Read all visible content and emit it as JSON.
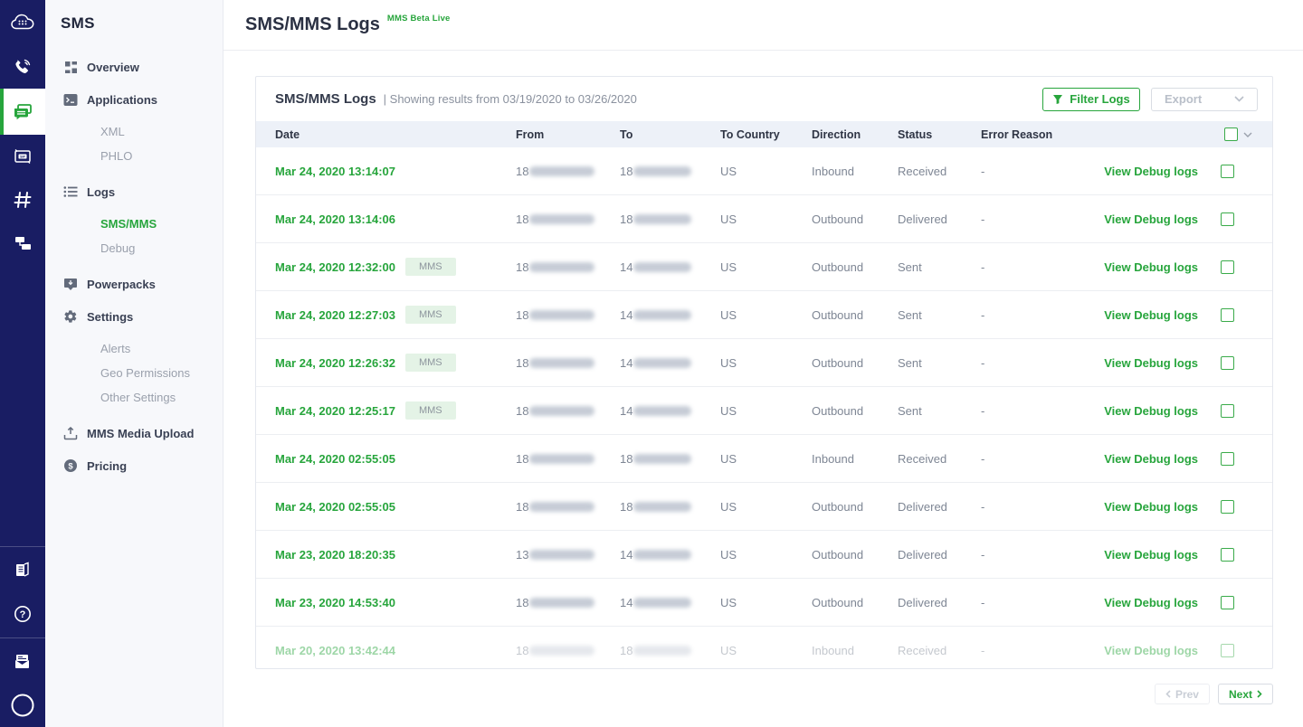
{
  "colors": {
    "accent_green": "#27A53C",
    "rail_navy": "#191D63",
    "table_header_bg": "#EDF1F8"
  },
  "rail": {
    "top_icons": [
      {
        "name": "plivo-logo-icon",
        "active": false
      },
      {
        "name": "voice-phone-icon",
        "active": false
      },
      {
        "name": "messaging-chat-icon",
        "active": true
      },
      {
        "name": "zentrunk-sip-icon",
        "active": false
      },
      {
        "name": "phone-numbers-hash-icon",
        "active": false
      },
      {
        "name": "phlo-nodes-icon",
        "active": false
      }
    ],
    "bottom_icons": [
      {
        "name": "docs-book-icon",
        "group": 1
      },
      {
        "name": "help-question-icon",
        "group": 1
      },
      {
        "name": "feedback-envelope-icon",
        "group": 2
      },
      {
        "name": "account-avatar-icon",
        "group": 2
      }
    ]
  },
  "sidebar": {
    "title": "SMS",
    "sections": [
      {
        "label": "Overview",
        "icon": "grid-icon",
        "children": []
      },
      {
        "label": "Applications",
        "icon": "terminal-icon",
        "children": [
          {
            "label": "XML"
          },
          {
            "label": "PHLO"
          }
        ]
      },
      {
        "label": "Logs",
        "icon": "list-icon",
        "children": [
          {
            "label": "SMS/MMS",
            "active": true
          },
          {
            "label": "Debug"
          }
        ]
      },
      {
        "label": "Powerpacks",
        "icon": "powerpack-icon",
        "children": []
      },
      {
        "label": "Settings",
        "icon": "gear-icon",
        "children": [
          {
            "label": "Alerts"
          },
          {
            "label": "Geo Permissions"
          },
          {
            "label": "Other Settings"
          }
        ]
      },
      {
        "label": "MMS Media Upload",
        "icon": "upload-icon",
        "children": []
      },
      {
        "label": "Pricing",
        "icon": "dollar-icon",
        "children": []
      }
    ]
  },
  "header": {
    "title": "SMS/MMS Logs",
    "beta_label": "MMS Beta Live"
  },
  "card": {
    "title": "SMS/MMS Logs",
    "subtitle": "| Showing results from 03/19/2020 to 03/26/2020",
    "filter_button": "Filter Logs",
    "export_button": "Export"
  },
  "table": {
    "columns": [
      "Date",
      "From",
      "To",
      "To Country",
      "Direction",
      "Status",
      "Error Reason"
    ],
    "mms_badge": "MMS",
    "debug_link_label": "View Debug logs",
    "rows": [
      {
        "date": "Mar 24, 2020 13:14:07",
        "mms": false,
        "from_prefix": "18",
        "to_prefix": "18",
        "country": "US",
        "direction": "Inbound",
        "status": "Received",
        "error": "-",
        "faded": false
      },
      {
        "date": "Mar 24, 2020 13:14:06",
        "mms": false,
        "from_prefix": "18",
        "to_prefix": "18",
        "country": "US",
        "direction": "Outbound",
        "status": "Delivered",
        "error": "-",
        "faded": false
      },
      {
        "date": "Mar 24, 2020 12:32:00",
        "mms": true,
        "from_prefix": "18",
        "to_prefix": "14",
        "country": "US",
        "direction": "Outbound",
        "status": "Sent",
        "error": "-",
        "faded": false
      },
      {
        "date": "Mar 24, 2020 12:27:03",
        "mms": true,
        "from_prefix": "18",
        "to_prefix": "14",
        "country": "US",
        "direction": "Outbound",
        "status": "Sent",
        "error": "-",
        "faded": false
      },
      {
        "date": "Mar 24, 2020 12:26:32",
        "mms": true,
        "from_prefix": "18",
        "to_prefix": "14",
        "country": "US",
        "direction": "Outbound",
        "status": "Sent",
        "error": "-",
        "faded": false
      },
      {
        "date": "Mar 24, 2020 12:25:17",
        "mms": true,
        "from_prefix": "18",
        "to_prefix": "14",
        "country": "US",
        "direction": "Outbound",
        "status": "Sent",
        "error": "-",
        "faded": false
      },
      {
        "date": "Mar 24, 2020 02:55:05",
        "mms": false,
        "from_prefix": "18",
        "to_prefix": "18",
        "country": "US",
        "direction": "Inbound",
        "status": "Received",
        "error": "-",
        "faded": false
      },
      {
        "date": "Mar 24, 2020 02:55:05",
        "mms": false,
        "from_prefix": "18",
        "to_prefix": "18",
        "country": "US",
        "direction": "Outbound",
        "status": "Delivered",
        "error": "-",
        "faded": false
      },
      {
        "date": "Mar 23, 2020 18:20:35",
        "mms": false,
        "from_prefix": "13",
        "to_prefix": "14",
        "country": "US",
        "direction": "Outbound",
        "status": "Delivered",
        "error": "-",
        "faded": false
      },
      {
        "date": "Mar 23, 2020 14:53:40",
        "mms": false,
        "from_prefix": "18",
        "to_prefix": "14",
        "country": "US",
        "direction": "Outbound",
        "status": "Delivered",
        "error": "-",
        "faded": false
      },
      {
        "date": "Mar 20, 2020 13:42:44",
        "mms": false,
        "from_prefix": "18",
        "to_prefix": "18",
        "country": "US",
        "direction": "Inbound",
        "status": "Received",
        "error": "-",
        "faded": true
      }
    ]
  },
  "pagination": {
    "prev": "Prev",
    "next": "Next"
  }
}
